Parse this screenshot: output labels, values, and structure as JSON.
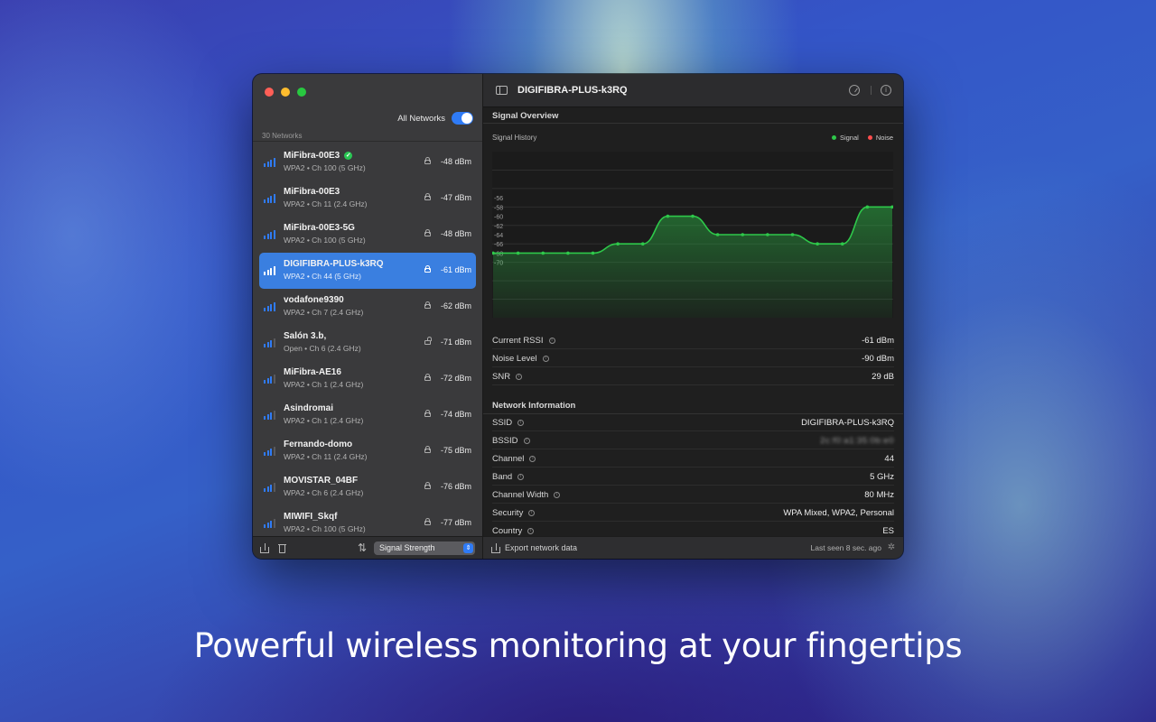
{
  "tagline": "Powerful wireless monitoring at your fingertips",
  "colors": {
    "accent": "#2f7bf6",
    "signal": "#2ec84a",
    "noise": "#ff4d4d",
    "connected": "#29c653"
  },
  "sidebar": {
    "toggle_label": "All Networks",
    "toggle_on": true,
    "count": "30 Networks",
    "networks": [
      {
        "name": "MiFibra-00E3",
        "sub": "WPA2 • Ch 100 (5 GHz)",
        "dbm": "-48 dBm",
        "connected": true,
        "locked": true
      },
      {
        "name": "MiFibra-00E3",
        "sub": "WPA2 • Ch 11 (2.4 GHz)",
        "dbm": "-47 dBm",
        "locked": true
      },
      {
        "name": "MiFibra-00E3-5G",
        "sub": "WPA2 • Ch 100 (5 GHz)",
        "dbm": "-48 dBm",
        "locked": true
      },
      {
        "name": "DIGIFIBRA-PLUS-k3RQ",
        "sub": "WPA2 • Ch 44 (5 GHz)",
        "dbm": "-61 dBm",
        "selected": true,
        "locked": true
      },
      {
        "name": "vodafone9390",
        "sub": "WPA2 • Ch 7 (2.4 GHz)",
        "dbm": "-62 dBm",
        "locked": true
      },
      {
        "name": "Salón 3.b,",
        "sub": "Open • Ch 6 (2.4 GHz)",
        "dbm": "-71 dBm",
        "locked": false
      },
      {
        "name": "MiFibra-AE16",
        "sub": "WPA2 • Ch 1 (2.4 GHz)",
        "dbm": "-72 dBm",
        "locked": true
      },
      {
        "name": "Asindromai",
        "sub": "WPA2 • Ch 1 (2.4 GHz)",
        "dbm": "-74 dBm",
        "locked": true
      },
      {
        "name": "Fernando-domo",
        "sub": "WPA2 • Ch 11 (2.4 GHz)",
        "dbm": "-75 dBm",
        "locked": true
      },
      {
        "name": "MOVISTAR_04BF",
        "sub": "WPA2 • Ch 6 (2.4 GHz)",
        "dbm": "-76 dBm",
        "locked": true
      },
      {
        "name": "MIWIFI_Skqf",
        "sub": "WPA2 • Ch 100 (5 GHz)",
        "dbm": "-77 dBm",
        "locked": true
      }
    ],
    "sort_icon": "sort-arrows-icon",
    "sort_label": "Signal Strength",
    "sort_chevron": "⌃"
  },
  "detail": {
    "title": "DIGIFIBRA-PLUS-k3RQ",
    "signal_overview_title": "Signal Overview",
    "chart_title": "Signal History",
    "legend": {
      "signal": "Signal",
      "noise": "Noise"
    },
    "signal_rows": [
      {
        "label": "Current RSSI",
        "value": "-61 dBm"
      },
      {
        "label": "Noise Level",
        "value": "-90 dBm"
      },
      {
        "label": "SNR",
        "value": "29 dB"
      }
    ],
    "network_info_title": "Network Information",
    "info_rows": [
      {
        "label": "SSID",
        "value": "DIGIFIBRA-PLUS-k3RQ"
      },
      {
        "label": "BSSID",
        "value": "2c:f0:a1:35:0b:e0",
        "blurred": true
      },
      {
        "label": "Channel",
        "value": "44"
      },
      {
        "label": "Band",
        "value": "5 GHz"
      },
      {
        "label": "Channel Width",
        "value": "80 MHz"
      },
      {
        "label": "Security",
        "value": "WPA Mixed, WPA2, Personal"
      },
      {
        "label": "Country",
        "value": "ES"
      }
    ],
    "export_label": "Export network data",
    "last_seen": "Last seen 8 sec. ago"
  },
  "chart_data": {
    "type": "line",
    "title": "Signal History",
    "ylabel": "",
    "y_ticks": [
      -56,
      -58,
      -60,
      -62,
      -64,
      -66,
      -68,
      -70
    ],
    "ylim": [
      -82,
      -46
    ],
    "series": [
      {
        "name": "Signal",
        "color": "#2ec84a",
        "values": [
          -68,
          -68,
          -68,
          -68,
          -68,
          -66,
          -66,
          -60,
          -60,
          -64,
          -64,
          -64,
          -64,
          -66,
          -66,
          -58,
          -58
        ]
      }
    ],
    "legend_position": "top-right",
    "grid": true
  }
}
